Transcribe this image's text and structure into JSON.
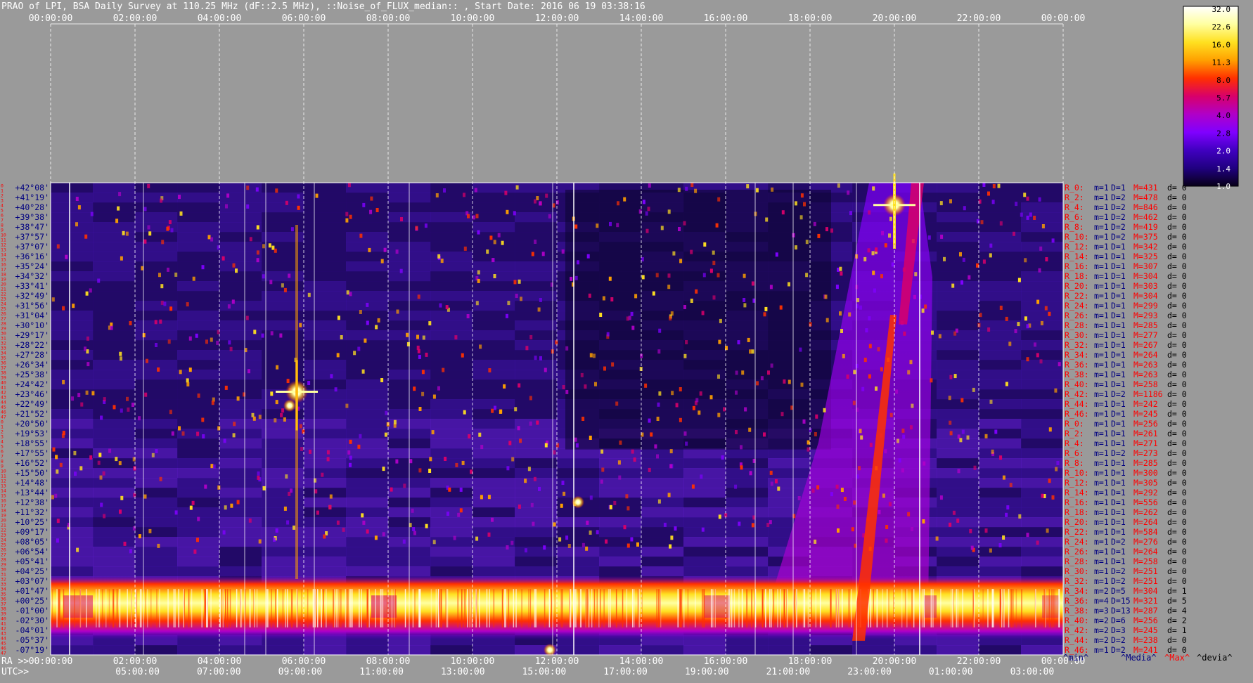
{
  "title": "PRAO of LPI, BSA Daily Survey at 110.25 MHz (dF::2.5 MHz), ::Noise_of_FLUX_median:: , Start Date: 2016 06 19 03:38:16",
  "chart_data": {
    "type": "heatmap",
    "top_ticks": [
      "00:00:00",
      "02:00:00",
      "04:00:00",
      "06:00:00",
      "08:00:00",
      "10:00:00",
      "12:00:00",
      "14:00:00",
      "16:00:00",
      "18:00:00",
      "20:00:00",
      "22:00:00",
      "00:00:00"
    ],
    "ra_label": "RA >>",
    "ra_ticks": [
      "00:00:00",
      "02:00:00",
      "04:00:00",
      "06:00:00",
      "08:00:00",
      "10:00:00",
      "12:00:00",
      "14:00:00",
      "16:00:00",
      "18:00:00",
      "20:00:00",
      "22:00:00",
      "00:00:00"
    ],
    "utc_label": "UTC>>",
    "utc_ticks": [
      "05:00:00",
      "07:00:00",
      "09:00:00",
      "11:00:00",
      "13:00:00",
      "15:00:00",
      "17:00:00",
      "19:00:00",
      "21:00:00",
      "23:00:00",
      "01:00:00",
      "03:00:00"
    ],
    "colorbar": {
      "ticks": [
        "32.0",
        "22.6",
        "16.0",
        "11.3",
        "8.0",
        "5.7",
        "4.0",
        "2.8",
        "2.0",
        "1.4",
        "1.0"
      ],
      "colors": [
        "#ffffff",
        "#ffffa0",
        "#ffe020",
        "#ffa000",
        "#ff3000",
        "#d8006a",
        "#b000c8",
        "#8000ff",
        "#4000c0",
        "#200080",
        "#080018"
      ]
    },
    "declinations": [
      "+42°08'",
      "+41°19'",
      "+40°28'",
      "+39°38'",
      "+38°47'",
      "+37°57'",
      "+37°07'",
      "+36°16'",
      "+35°24'",
      "+34°32'",
      "+33°41'",
      "+32°49'",
      "+31°56'",
      "+31°04'",
      "+30°10'",
      "+29°17'",
      "+28°22'",
      "+27°28'",
      "+26°34'",
      "+25°38'",
      "+24°42'",
      "+23°46'",
      "+22°49'",
      "+21°52'",
      "+20°50'",
      "+19°53'",
      "+18°55'",
      "+17°55'",
      "+16°52'",
      "+15°50'",
      "+14°48'",
      "+13°44'",
      "+12°38'",
      "+11°32'",
      "+10°25'",
      "+09°17'",
      "+08°05'",
      "+06°54'",
      "+05°41'",
      "+04°25'",
      "+03°07'",
      "+01°47'",
      "+00°25'",
      "-01°00'",
      "-02°30'",
      "-04°01'",
      "-05°37'",
      "-07°19'"
    ],
    "beam_numbers": [
      "0",
      "1",
      "2",
      "3",
      "4",
      "5",
      "6",
      "7",
      "8",
      "9",
      "10",
      "11",
      "12",
      "13",
      "14",
      "15",
      "16",
      "17",
      "18",
      "19",
      "20",
      "21",
      "22",
      "23",
      "24",
      "25",
      "26",
      "27",
      "28",
      "29",
      "30",
      "31",
      "32",
      "33",
      "34",
      "35",
      "36",
      "37",
      "38",
      "39",
      "40",
      "41",
      "42",
      "43",
      "44",
      "45",
      "46",
      "47",
      "0",
      "1",
      "2",
      "3",
      "4",
      "5",
      "6",
      "7",
      "8",
      "9",
      "10",
      "11",
      "12",
      "13",
      "14",
      "15",
      "16",
      "17",
      "18",
      "19",
      "20",
      "21",
      "22",
      "23",
      "24",
      "25",
      "26",
      "27",
      "28",
      "29",
      "30",
      "31",
      "32",
      "33",
      "34",
      "35",
      "36",
      "37",
      "38",
      "39",
      "40",
      "41",
      "42",
      "43",
      "44",
      "45",
      "46",
      "47"
    ],
    "row_stats": [
      {
        "r": "R_0:",
        "m": "m=1",
        "D": "D=1",
        "M": "M=431",
        "d": "d= 0"
      },
      {
        "r": "R_2:",
        "m": "m=1",
        "D": "D=2",
        "M": "M=478",
        "d": "d= 0"
      },
      {
        "r": "R_4:",
        "m": "m=1",
        "D": "D=2",
        "M": "M=846",
        "d": "d= 0"
      },
      {
        "r": "R_6:",
        "m": "m=1",
        "D": "D=2",
        "M": "M=462",
        "d": "d= 0"
      },
      {
        "r": "R_8:",
        "m": "m=1",
        "D": "D=2",
        "M": "M=419",
        "d": "d= 0"
      },
      {
        "r": "R_10:",
        "m": "m=1",
        "D": "D=2",
        "M": "M=375",
        "d": "d= 0"
      },
      {
        "r": "R_12:",
        "m": "m=1",
        "D": "D=1",
        "M": "M=342",
        "d": "d= 0"
      },
      {
        "r": "R_14:",
        "m": "m=1",
        "D": "D=1",
        "M": "M=325",
        "d": "d= 0"
      },
      {
        "r": "R_16:",
        "m": "m=1",
        "D": "D=1",
        "M": "M=307",
        "d": "d= 0"
      },
      {
        "r": "R_18:",
        "m": "m=1",
        "D": "D=1",
        "M": "M=304",
        "d": "d= 0"
      },
      {
        "r": "R_20:",
        "m": "m=1",
        "D": "D=1",
        "M": "M=303",
        "d": "d= 0"
      },
      {
        "r": "R_22:",
        "m": "m=1",
        "D": "D=1",
        "M": "M=304",
        "d": "d= 0"
      },
      {
        "r": "R_24:",
        "m": "m=1",
        "D": "D=1",
        "M": "M=299",
        "d": "d= 0"
      },
      {
        "r": "R_26:",
        "m": "m=1",
        "D": "D=1",
        "M": "M=293",
        "d": "d= 0"
      },
      {
        "r": "R_28:",
        "m": "m=1",
        "D": "D=1",
        "M": "M=285",
        "d": "d= 0"
      },
      {
        "r": "R_30:",
        "m": "m=1",
        "D": "D=1",
        "M": "M=277",
        "d": "d= 0"
      },
      {
        "r": "R_32:",
        "m": "m=1",
        "D": "D=1",
        "M": "M=267",
        "d": "d= 0"
      },
      {
        "r": "R_34:",
        "m": "m=1",
        "D": "D=1",
        "M": "M=264",
        "d": "d= 0"
      },
      {
        "r": "R_36:",
        "m": "m=1",
        "D": "D=1",
        "M": "M=263",
        "d": "d= 0"
      },
      {
        "r": "R_38:",
        "m": "m=1",
        "D": "D=1",
        "M": "M=263",
        "d": "d= 0"
      },
      {
        "r": "R_40:",
        "m": "m=1",
        "D": "D=1",
        "M": "M=258",
        "d": "d= 0"
      },
      {
        "r": "R_42:",
        "m": "m=1",
        "D": "D=2",
        "M": "M=1186",
        "d": "d= 0"
      },
      {
        "r": "R_44:",
        "m": "m=1",
        "D": "D=1",
        "M": "M=242",
        "d": "d= 0"
      },
      {
        "r": "R_46:",
        "m": "m=1",
        "D": "D=1",
        "M": "M=245",
        "d": "d= 0"
      },
      {
        "r": "R_0:",
        "m": "m=1",
        "D": "D=1",
        "M": "M=256",
        "d": "d= 0"
      },
      {
        "r": "R_2:",
        "m": "m=1",
        "D": "D=1",
        "M": "M=261",
        "d": "d= 0"
      },
      {
        "r": "R_4:",
        "m": "m=1",
        "D": "D=1",
        "M": "M=271",
        "d": "d= 0"
      },
      {
        "r": "R_6:",
        "m": "m=1",
        "D": "D=2",
        "M": "M=273",
        "d": "d= 0"
      },
      {
        "r": "R_8:",
        "m": "m=1",
        "D": "D=1",
        "M": "M=285",
        "d": "d= 0"
      },
      {
        "r": "R_10:",
        "m": "m=1",
        "D": "D=1",
        "M": "M=300",
        "d": "d= 0"
      },
      {
        "r": "R_12:",
        "m": "m=1",
        "D": "D=1",
        "M": "M=305",
        "d": "d= 0"
      },
      {
        "r": "R_14:",
        "m": "m=1",
        "D": "D=1",
        "M": "M=292",
        "d": "d= 0"
      },
      {
        "r": "R_16:",
        "m": "m=1",
        "D": "D=1",
        "M": "M=556",
        "d": "d= 0"
      },
      {
        "r": "R_18:",
        "m": "m=1",
        "D": "D=1",
        "M": "M=262",
        "d": "d= 0"
      },
      {
        "r": "R_20:",
        "m": "m=1",
        "D": "D=1",
        "M": "M=264",
        "d": "d= 0"
      },
      {
        "r": "R_22:",
        "m": "m=1",
        "D": "D=1",
        "M": "M=584",
        "d": "d= 0"
      },
      {
        "r": "R_24:",
        "m": "m=1",
        "D": "D=2",
        "M": "M=276",
        "d": "d= 0"
      },
      {
        "r": "R_26:",
        "m": "m=1",
        "D": "D=1",
        "M": "M=264",
        "d": "d= 0"
      },
      {
        "r": "R_28:",
        "m": "m=1",
        "D": "D=1",
        "M": "M=258",
        "d": "d= 0"
      },
      {
        "r": "R_30:",
        "m": "m=1",
        "D": "D=2",
        "M": "M=251",
        "d": "d= 0"
      },
      {
        "r": "R_32:",
        "m": "m=1",
        "D": "D=2",
        "M": "M=251",
        "d": "d= 0"
      },
      {
        "r": "R_34:",
        "m": "m=2",
        "D": "D=5",
        "M": "M=304",
        "d": "d= 1"
      },
      {
        "r": "R_36:",
        "m": "m=4",
        "D": "D=15",
        "M": "M=321",
        "d": "d= 5"
      },
      {
        "r": "R_38:",
        "m": "m=3",
        "D": "D=13",
        "M": "M=287",
        "d": "d= 4"
      },
      {
        "r": "R_40:",
        "m": "m=2",
        "D": "D=6",
        "M": "M=256",
        "d": "d= 2"
      },
      {
        "r": "R_42:",
        "m": "m=2",
        "D": "D=3",
        "M": "M=245",
        "d": "d= 1"
      },
      {
        "r": "R_44:",
        "m": "m=2",
        "D": "D=2",
        "M": "M=238",
        "d": "d= 0"
      },
      {
        "r": "R_46:",
        "m": "m=1",
        "D": "D=2",
        "M": "M=241",
        "d": "d= 0"
      }
    ],
    "stats_legend": {
      "min": "^min^",
      "median": "^Media^",
      "max": "^Max^",
      "dev": "^devia^"
    },
    "bright_sources": [
      {
        "ra": "05:50",
        "dec": "+24°00'",
        "level": "32.0"
      },
      {
        "ra": "05:40",
        "dec": "+22°40'",
        "level": "22.6"
      },
      {
        "ra": "20:00",
        "dec": "+40°40'",
        "level": "32.0"
      },
      {
        "ra": "12:30",
        "dec": "+12°40'",
        "level": "16.0"
      },
      {
        "ra": "11:50",
        "dec": "-07°19'",
        "level": "22.6"
      }
    ],
    "colors": {
      "background": "#9a9a9a",
      "text_blue": "#000080",
      "text_red": "#ff0000",
      "axis_text": "#ffffff"
    }
  }
}
